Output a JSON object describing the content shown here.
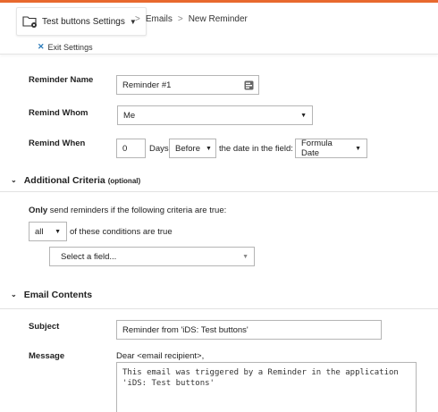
{
  "header": {
    "app_menu_label": "Test buttons Settings",
    "app_menu_icon": "folder-gear-icon",
    "breadcrumb": [
      {
        "label": "Emails"
      },
      {
        "label": "New Reminder"
      }
    ],
    "breadcrumb_separator": ">",
    "exit_settings": "Exit Settings"
  },
  "colors": {
    "accent_bar": "#e8692e",
    "link_blue": "#2a7ab9"
  },
  "form": {
    "reminder_name": {
      "label": "Reminder Name",
      "value": "Reminder #1",
      "icon": "field-picker-icon"
    },
    "remind_whom": {
      "label": "Remind Whom",
      "value": "Me"
    },
    "remind_when": {
      "label": "Remind When",
      "days_value": "0",
      "days_text": "Days",
      "direction": "Before",
      "middle_text": "the date in the field:",
      "field": "Formula Date"
    }
  },
  "additional_criteria": {
    "title": "Additional Criteria",
    "optional": "(optional)",
    "only_bold": "Only",
    "only_rest": "send reminders if the following criteria are true:",
    "match_value": "all",
    "match_text": "of these conditions are true",
    "field_placeholder": "Select a field..."
  },
  "email_contents": {
    "title": "Email Contents",
    "subject_label": "Subject",
    "subject_value": "Reminder from 'iDS: Test buttons'",
    "message_label": "Message",
    "message_greeting": "Dear <email recipient>,",
    "message_body": "This email was triggered by a Reminder in the application 'iDS: Test buttons'"
  }
}
